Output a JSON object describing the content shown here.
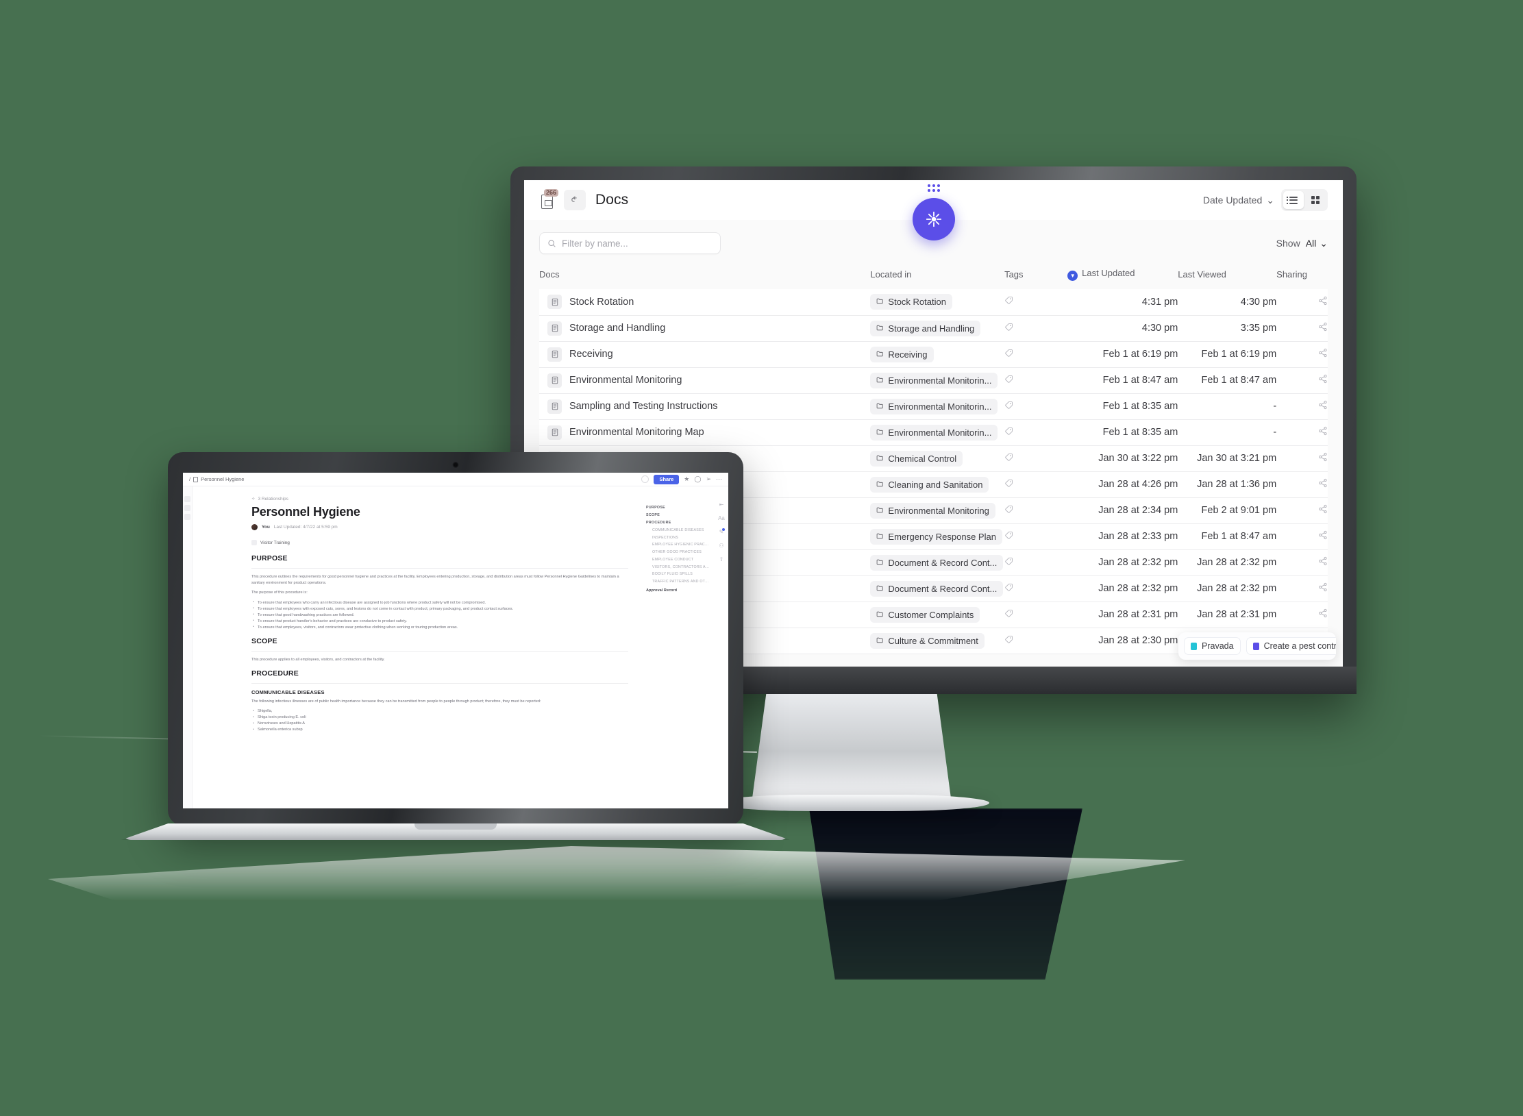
{
  "background_color": "#477050",
  "monitor_app": {
    "topbar": {
      "doc_count_badge": "266",
      "back_label": "↰",
      "title": "Docs",
      "sort_label": "Date Updated",
      "sort_caret": "⌄",
      "view_list_name": "list-view",
      "view_grid_name": "grid-view"
    },
    "ai_button": {
      "glyph": "✳",
      "color": "#5b4ee8"
    },
    "filter": {
      "placeholder": "Filter by name...",
      "search_icon": "search-icon"
    },
    "show": {
      "label": "Show",
      "value": "All",
      "caret": "⌄"
    },
    "columns": {
      "docs": "Docs",
      "located_in": "Located in",
      "tags": "Tags",
      "last_updated": "Last Updated",
      "last_viewed": "Last Viewed",
      "sharing": "Sharing"
    },
    "rows": [
      {
        "name": "Stock Rotation",
        "folder": "Stock Rotation",
        "updated": "4:31 pm",
        "viewed": "4:30 pm"
      },
      {
        "name": "Storage and Handling",
        "folder": "Storage and Handling",
        "updated": "4:30 pm",
        "viewed": "3:35 pm"
      },
      {
        "name": "Receiving",
        "folder": "Receiving",
        "updated": "Feb 1 at 6:19 pm",
        "viewed": "Feb 1 at 6:19 pm"
      },
      {
        "name": "Environmental Monitoring",
        "folder": "Environmental Monitorin...",
        "updated": "Feb 1 at 8:47 am",
        "viewed": "Feb 1 at 8:47 am"
      },
      {
        "name": "Sampling and Testing Instructions",
        "folder": "Environmental Monitorin...",
        "updated": "Feb 1 at 8:35 am",
        "viewed": "-"
      },
      {
        "name": "Environmental Monitoring Map",
        "folder": "Environmental Monitorin...",
        "updated": "Feb 1 at 8:35 am",
        "viewed": "-"
      },
      {
        "name": "Chemical Control",
        "folder": "Chemical Control",
        "updated": "Jan 30 at 3:22 pm",
        "viewed": "Jan 30 at 3:21 pm"
      },
      {
        "name": "",
        "folder": "Cleaning and Sanitation",
        "updated": "Jan 28 at 4:26 pm",
        "viewed": "Jan 28 at 1:36 pm"
      },
      {
        "name": "",
        "folder": "Environmental Monitoring",
        "updated": "Jan 28 at 2:34 pm",
        "viewed": "Feb 2 at 9:01 pm"
      },
      {
        "name": "",
        "folder": "Emergency Response Plan",
        "updated": "Jan 28 at 2:33 pm",
        "viewed": "Feb 1 at 8:47 am"
      },
      {
        "name": "",
        "folder": "Document & Record Cont...",
        "updated": "Jan 28 at 2:32 pm",
        "viewed": "Jan 28 at 2:32 pm"
      },
      {
        "name": "",
        "folder": "Document & Record Cont...",
        "updated": "Jan 28 at 2:32 pm",
        "viewed": "Jan 28 at 2:32 pm"
      },
      {
        "name": "",
        "folder": "Customer Complaints",
        "updated": "Jan 28 at 2:31 pm",
        "viewed": "Jan 28 at 2:31 pm"
      },
      {
        "name": "",
        "folder": "Culture & Commitment",
        "updated": "Jan 28 at 2:30 pm",
        "viewed": ""
      }
    ],
    "toasts": [
      {
        "label": "Pravada",
        "color": "#23c3d6"
      },
      {
        "label": "Create a pest control sigh",
        "color": "#5b4ee8"
      }
    ]
  },
  "laptop_app": {
    "breadcrumb": "Personnel Hygiene",
    "toolbar": {
      "share_label": "Share",
      "star_icon": "★",
      "comment_icon": "◯",
      "send_icon": "➢",
      "more_icon": "⋯"
    },
    "relationships": "3 Relationships",
    "title": "Personnel Hygiene",
    "author": "You",
    "last_updated": "Last Updated: 4/7/22 at 5:59 pm",
    "related_doc": "Visitor Training",
    "sections": [
      {
        "heading": "PURPOSE",
        "paragraphs": [
          "This procedure outlines the requirements for good personnel hygiene and practices at the facility. Employees entering production, storage, and distribution areas must follow Personnel Hygiene Guidelines to maintain a sanitary environment for product operations.",
          "The purpose of this procedure is:"
        ],
        "bullets": [
          "To ensure that employees who carry an infectious disease are assigned to job functions where product safety will not be compromised.",
          "To ensure that employees with exposed cuts, sores, and lesions do not come in contact with product, primary packaging, and product contact surfaces.",
          "To ensure that good handwashing practices are followed.",
          "To ensure that product handler's behavior and practices are conducive to product safety.",
          "To ensure that employees, visitors, and contractors wear protective clothing when working or touring production areas."
        ]
      },
      {
        "heading": "SCOPE",
        "paragraphs": [
          "This procedure applies to all employees, visitors, and contractors at the facility."
        ],
        "bullets": []
      },
      {
        "heading": "PROCEDURE",
        "paragraphs": [],
        "bullets": []
      }
    ],
    "subsection": {
      "heading": "COMMUNICABLE DISEASES",
      "paragraph": "The following infectious illnesses are of public health importance because they can be transmitted from people to people through product; therefore, they must be reported:",
      "bullets": [
        "Shigella,",
        "Shiga toxin producing E. coli",
        "Noroviruses and Hepatitis A",
        "Salmonella enterica subsp"
      ]
    },
    "toc": {
      "items": [
        {
          "label": "PURPOSE",
          "level": 1
        },
        {
          "label": "SCOPE",
          "level": 1
        },
        {
          "label": "PROCEDURE",
          "level": 1
        },
        {
          "label": "COMMUNICABLE DISEASES",
          "level": 2
        },
        {
          "label": "INSPECTIONS",
          "level": 2
        },
        {
          "label": "EMPLOYEE HYGIENIC PRACTICES",
          "level": 2
        },
        {
          "label": "OTHER GOOD PRACTICES",
          "level": 2
        },
        {
          "label": "EMPLOYEE CONDUCT",
          "level": 2
        },
        {
          "label": "VISITORS, CONTRACTORS AND ...",
          "level": 2
        },
        {
          "label": "BODILY FLUID SPILLS",
          "level": 2
        },
        {
          "label": "TRAFFIC PATTERNS AND OTHER ...",
          "level": 2
        }
      ],
      "footer": "Approval Record"
    },
    "side_icons": [
      "collapse-icon",
      "text-size-icon",
      "edit-icon",
      "people-icon",
      "export-icon"
    ]
  }
}
